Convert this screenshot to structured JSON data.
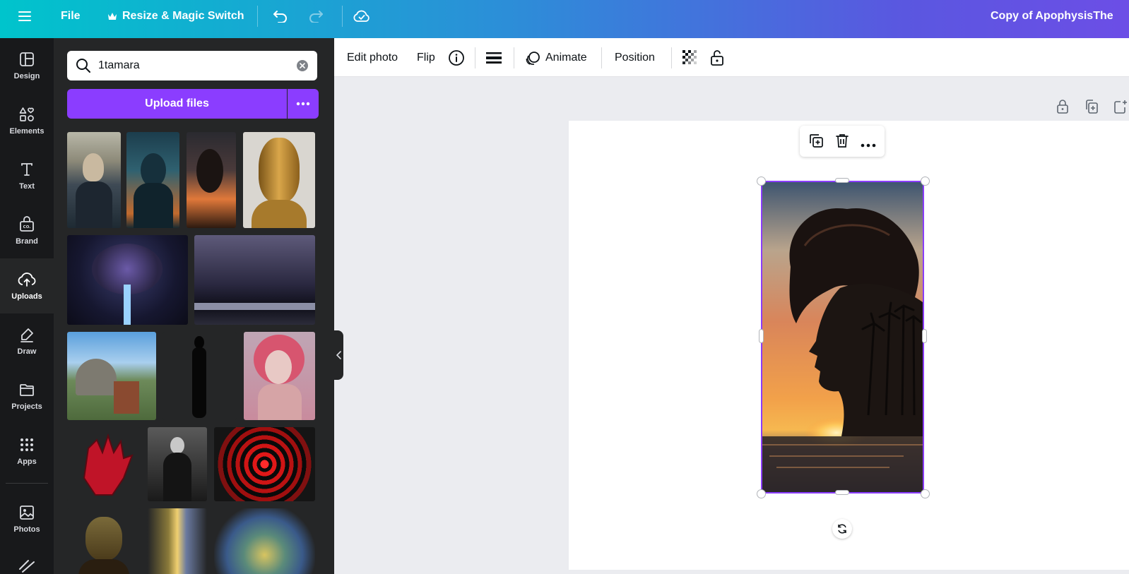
{
  "topbar": {
    "file_label": "File",
    "resize_label": "Resize & Magic Switch",
    "doc_title": "Copy of ApophysisThe"
  },
  "rail": {
    "items": [
      {
        "label": "Design",
        "icon": "design-icon"
      },
      {
        "label": "Elements",
        "icon": "elements-icon"
      },
      {
        "label": "Text",
        "icon": "text-icon"
      },
      {
        "label": "Brand",
        "icon": "brand-icon"
      },
      {
        "label": "Uploads",
        "icon": "upload-cloud-icon"
      },
      {
        "label": "Draw",
        "icon": "draw-icon"
      },
      {
        "label": "Projects",
        "icon": "folder-icon"
      },
      {
        "label": "Apps",
        "icon": "apps-grid-icon"
      },
      {
        "label": "Photos",
        "icon": "photos-icon"
      }
    ],
    "active": "Uploads"
  },
  "panel": {
    "search_value": "1tamara",
    "upload_label": "Upload files"
  },
  "toolbar": {
    "edit_photo": "Edit photo",
    "flip": "Flip",
    "animate": "Animate",
    "position": "Position"
  },
  "colors": {
    "accent": "#8b3dff",
    "rail_bg": "#18191b",
    "panel_bg": "#252627"
  }
}
